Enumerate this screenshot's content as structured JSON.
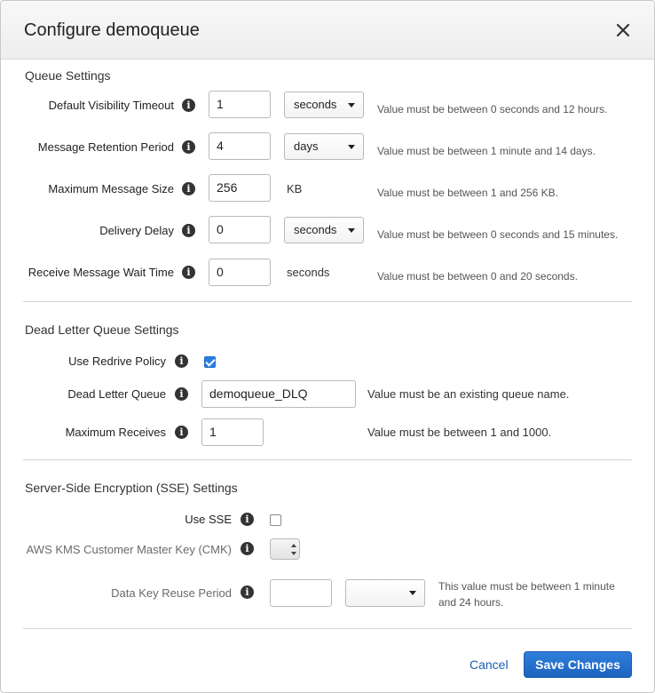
{
  "dialog": {
    "title": "Configure demoqueue",
    "close_glyph": "✕"
  },
  "queue_settings": {
    "title": "Queue Settings",
    "rows": [
      {
        "label": "Default Visibility Timeout",
        "value": "1",
        "unit_select": "seconds",
        "hint": "Value must be between 0 seconds and 12 hours."
      },
      {
        "label": "Message Retention Period",
        "value": "4",
        "unit_select": "days",
        "hint": "Value must be between 1 minute and 14 days."
      },
      {
        "label": "Maximum Message Size",
        "value": "256",
        "unit_text": "KB",
        "hint": "Value must be between 1 and 256 KB."
      },
      {
        "label": "Delivery Delay",
        "value": "0",
        "unit_select": "seconds",
        "hint": "Value must be between 0 seconds and 15 minutes."
      },
      {
        "label": "Receive Message Wait Time",
        "value": "0",
        "unit_text": "seconds",
        "hint": "Value must be between 0 and 20 seconds."
      }
    ]
  },
  "dlq_settings": {
    "title": "Dead Letter Queue Settings",
    "use_redrive_label": "Use Redrive Policy",
    "use_redrive_checked": true,
    "dlq_label": "Dead Letter Queue",
    "dlq_value": "demoqueue_DLQ",
    "dlq_hint": "Value must be an existing queue name.",
    "max_receives_label": "Maximum Receives",
    "max_receives_value": "1",
    "max_receives_hint": "Value must be between 1 and 1000."
  },
  "sse_settings": {
    "title": "Server-Side Encryption (SSE) Settings",
    "use_sse_label": "Use SSE",
    "use_sse_checked": false,
    "cmk_label": "AWS KMS Customer Master Key (CMK)",
    "reuse_label": "Data Key Reuse Period",
    "reuse_value": "",
    "reuse_unit": "",
    "reuse_hint": "This value must be between 1 minute and 24 hours."
  },
  "footer": {
    "cancel_label": "Cancel",
    "save_label": "Save Changes"
  },
  "icons": {
    "info_glyph": "i"
  },
  "colors": {
    "accent": "#1e63c0",
    "link": "#1a5fb4"
  }
}
